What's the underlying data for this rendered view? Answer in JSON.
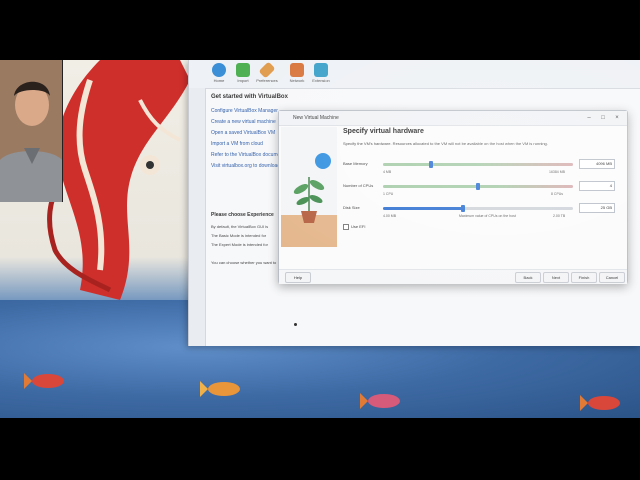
{
  "vbox": {
    "toolbar": [
      {
        "label": "Home",
        "icon": "home-icon",
        "color": "#3a8fd6"
      },
      {
        "label": "Import",
        "icon": "import-icon",
        "color": "#4caf50"
      },
      {
        "label": "Preferences",
        "icon": "preferences-icon",
        "color": "#e09a4a"
      },
      {
        "label": "Network",
        "icon": "network-icon",
        "color": "#d8743a"
      },
      {
        "label": "Extension",
        "icon": "extension-icon",
        "color": "#3aa0c8"
      }
    ],
    "welcome": {
      "title": "Get started with VirtualBox",
      "links": [
        "Configure VirtualBox Manager",
        "Create a new virtual machine",
        "Open a saved VirtualBox VM",
        "Import a VM from cloud",
        "Refer to the VirtualBox documentation",
        "Visit virtualbox.org to download"
      ]
    },
    "experience": {
      "title": "Please choose Experience",
      "lines": [
        "By default, the VirtualBox GUI is",
        "The Basic Mode is intended for",
        "The Expert Mode is intended for",
        "",
        "You can choose whether you want to"
      ]
    }
  },
  "dialog": {
    "title": "New Virtual Machine",
    "heading": "Specify virtual hardware",
    "description": "Specify the VM's hardware. Resources allocated to the VM will not be available on the host when the VM is running.",
    "memory": {
      "label": "Base Memory",
      "value": "4096 MB",
      "min": "4 MB",
      "max": "16384 MB",
      "fraction": 0.25
    },
    "cpus": {
      "label": "Number of CPUs",
      "value": "4",
      "min": "1 CPU",
      "max": "8 CPUs",
      "fraction": 0.5
    },
    "disk": {
      "label": "Disk Size",
      "value": "25 GB",
      "min": "4.00 MB",
      "max": "2.00 TB",
      "fraction": 0.42,
      "note": "Maximum value of CPUs on the host"
    },
    "efi_label": "Use EFI",
    "efi_checked": false,
    "buttons": {
      "help": "Help",
      "back": "Back",
      "next": "Next",
      "finish": "Finish",
      "cancel": "Cancel"
    },
    "colors": {
      "accent": "#2c6fd1",
      "track_green": "#7fc27a",
      "track_red": "#e28a8a"
    }
  }
}
